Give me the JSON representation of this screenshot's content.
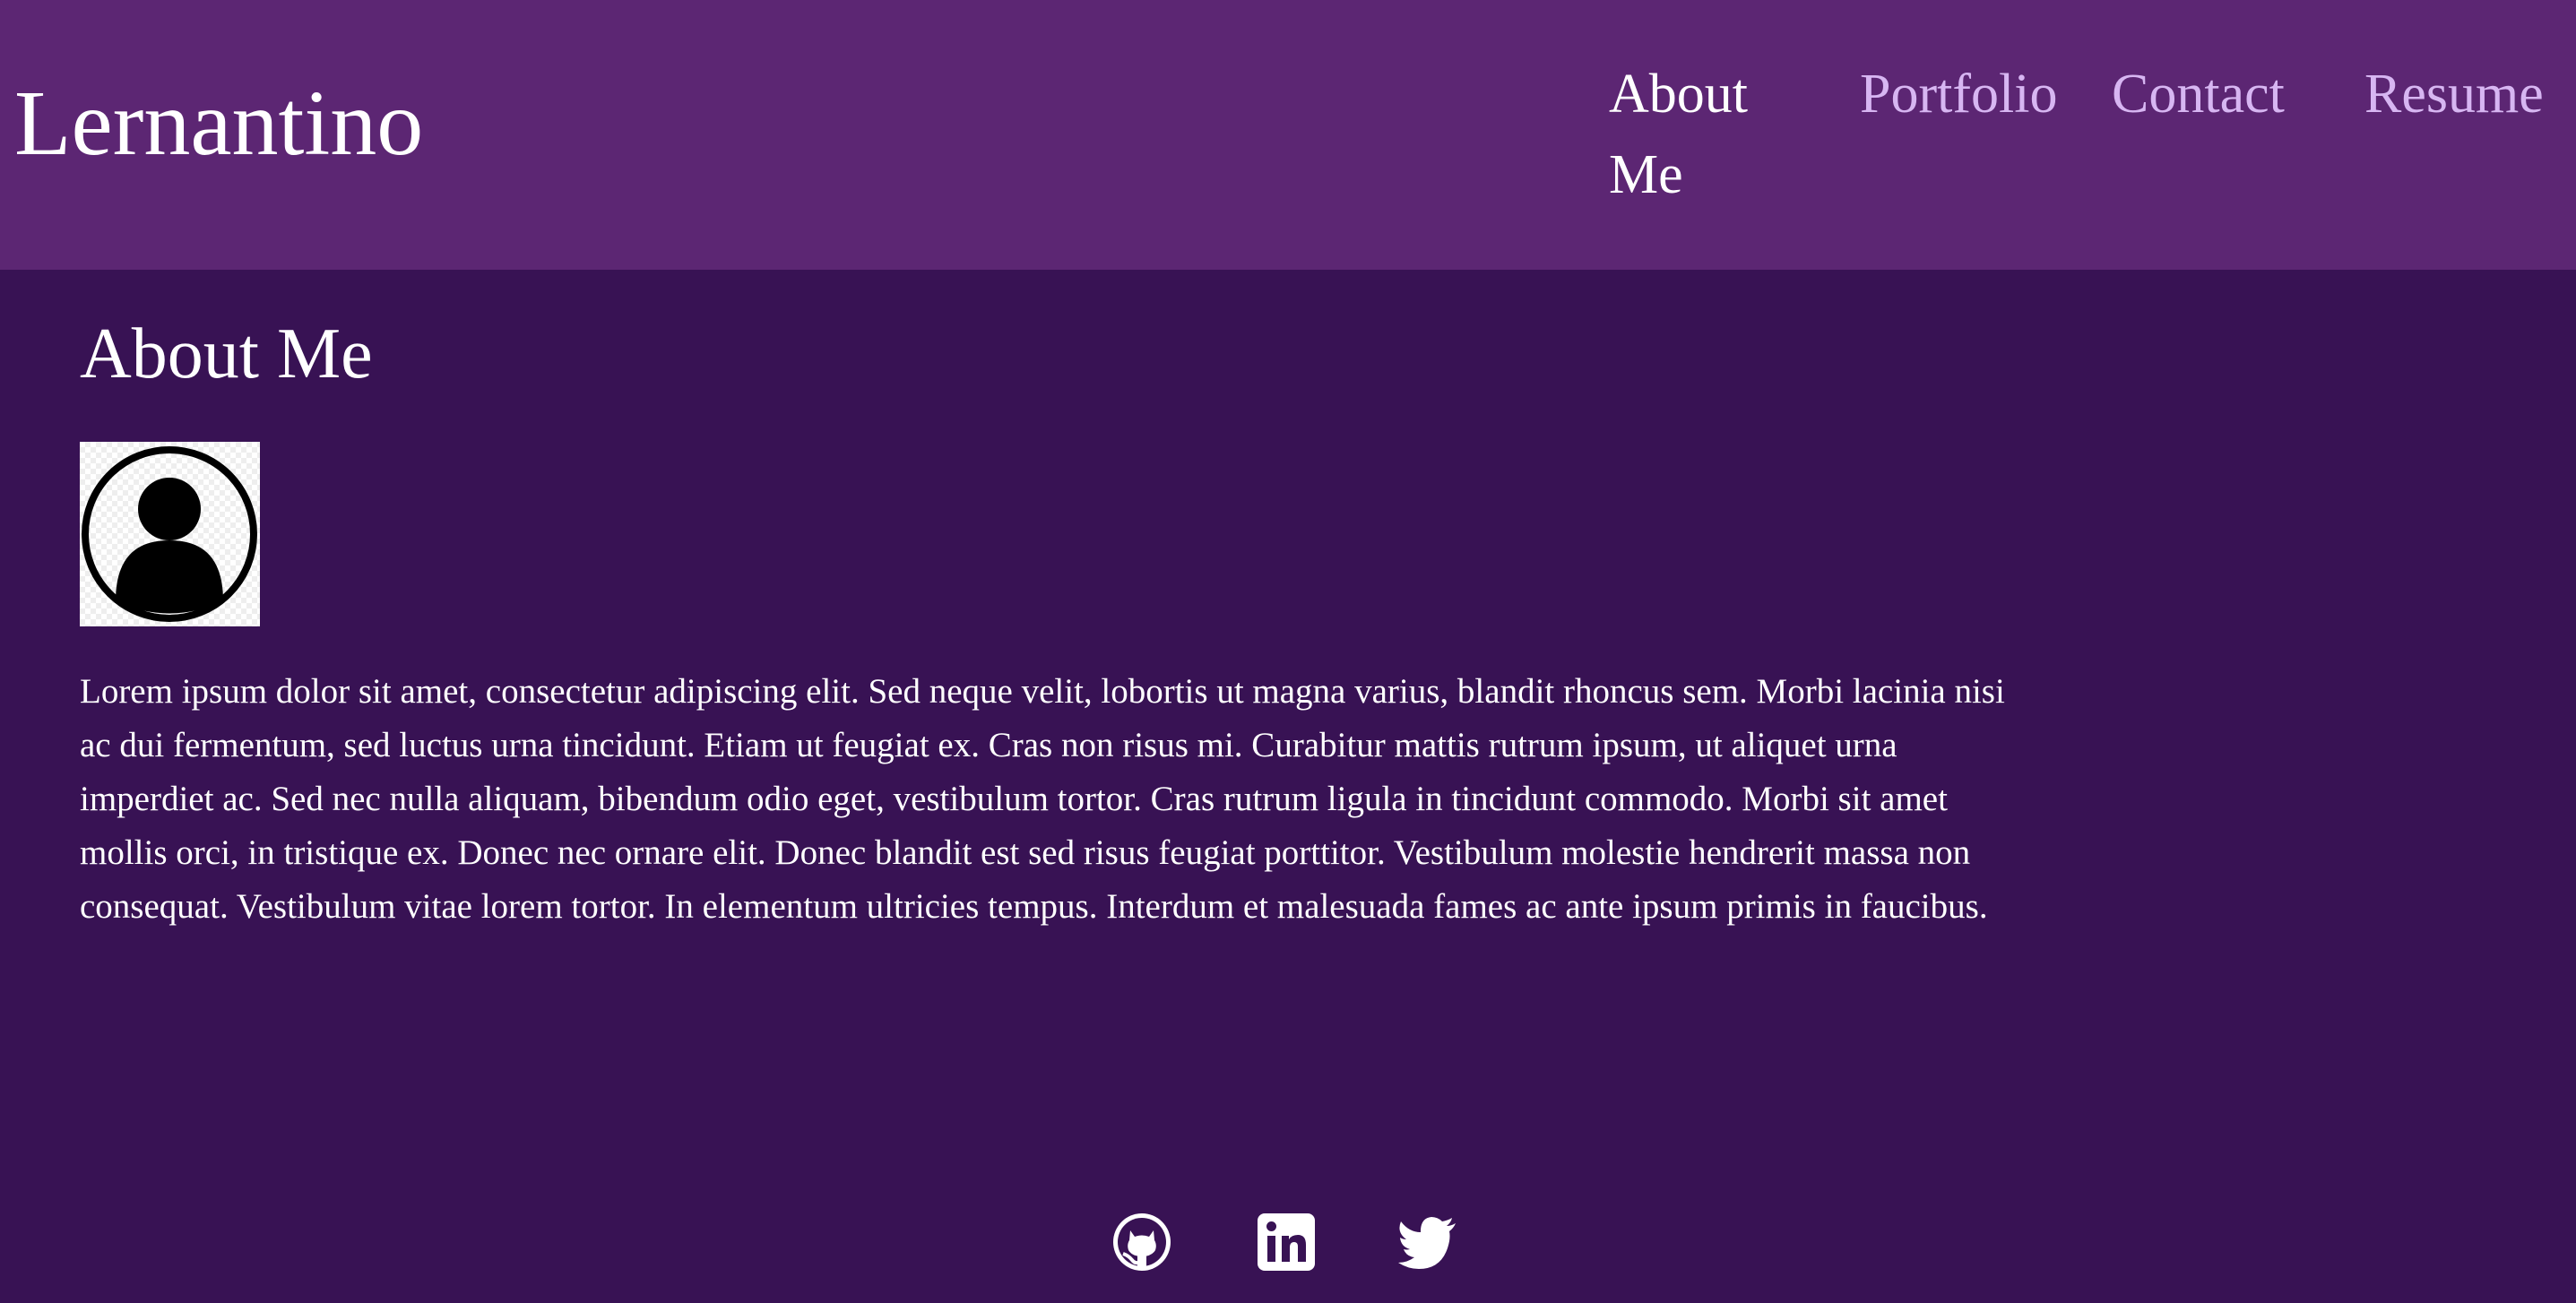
{
  "site": {
    "brand": "Lernantino"
  },
  "nav": {
    "items": [
      {
        "label": "About Me",
        "active": true
      },
      {
        "label": "Portfolio",
        "active": false
      },
      {
        "label": "Contact",
        "active": false
      },
      {
        "label": "Resume",
        "active": false
      }
    ]
  },
  "about": {
    "title": "About Me",
    "avatar_icon": "user-avatar-icon",
    "bio": "Lorem ipsum dolor sit amet, consectetur adipiscing elit. Sed neque velit, lobortis ut magna varius, blandit rhoncus sem. Morbi lacinia nisi ac dui fermentum, sed luctus urna tincidunt. Etiam ut feugiat ex. Cras non risus mi. Curabitur mattis rutrum ipsum, ut aliquet urna imperdiet ac. Sed nec nulla aliquam, bibendum odio eget, vestibulum tortor. Cras rutrum ligula in tincidunt commodo. Morbi sit amet mollis orci, in tristique ex. Donec nec ornare elit. Donec blandit est sed risus feugiat porttitor. Vestibulum molestie hendrerit massa non consequat. Vestibulum vitae lorem tortor. In elementum ultricies tempus. Interdum et malesuada fames ac ante ipsum primis in faucibus."
  },
  "footer": {
    "social_icons": [
      "github-icon",
      "linkedin-icon",
      "twitter-icon"
    ]
  },
  "colors": {
    "header_bg": "#5c2673",
    "page_bg": "#381254",
    "nav_inactive": "#d7b6f2",
    "text": "#ffffff"
  }
}
